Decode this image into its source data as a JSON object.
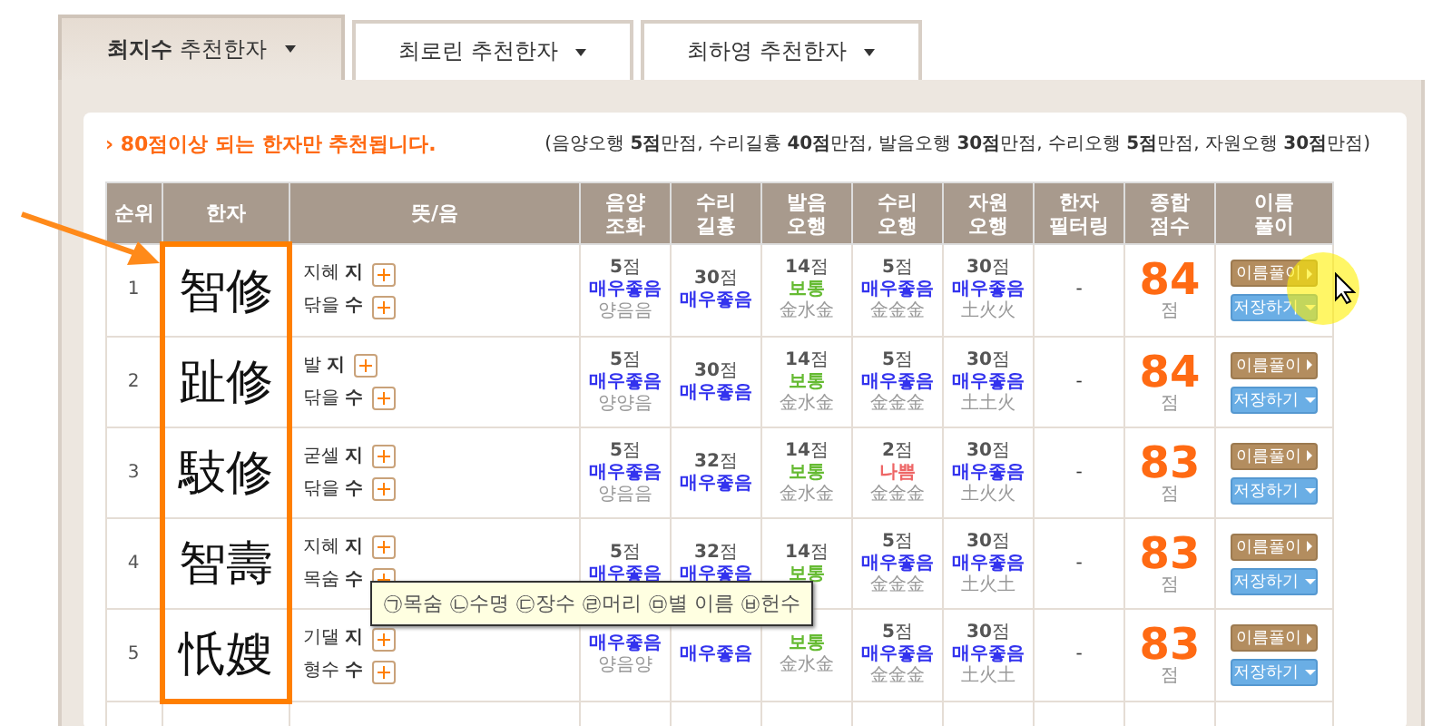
{
  "tabs": [
    {
      "label": "**최지수** 추천한자",
      "selected": true
    },
    {
      "label": "최로린 추천한자",
      "selected": false
    },
    {
      "label": "최하영 추천한자",
      "selected": false
    }
  ],
  "notice": "› 80점이상 되는 한자만 추천됩니다.",
  "legend": "(음양오행 **5점**만점, 수리길흉 **40점**만점, 발음오행 **30점**만점, 수리오행 **5점**만점, 자원오행 **30점**만점)",
  "columns": [
    [
      "순위"
    ],
    [
      "한자"
    ],
    [
      "뜻/음"
    ],
    [
      "음양",
      "조화"
    ],
    [
      "수리",
      "길흉"
    ],
    [
      "발음",
      "오행"
    ],
    [
      "수리",
      "오행"
    ],
    [
      "자원",
      "오행"
    ],
    [
      "한자",
      "필터링"
    ],
    [
      "종합",
      "점수"
    ],
    [
      "이름",
      "풀이"
    ]
  ],
  "rows": [
    {
      "rank": "1",
      "hanja": "智修",
      "readings": [
        {
          "meaning": "지혜",
          "sound": "지"
        },
        {
          "meaning": "닦을",
          "sound": "수"
        }
      ],
      "scores": [
        {
          "score": "**5**점",
          "verdict": "매우좋음",
          "kind": "great",
          "detail": "양음음"
        },
        {
          "score": "**30**점",
          "verdict": "매우좋음",
          "kind": "great"
        },
        {
          "score": "**14**점",
          "verdict": "보통",
          "kind": "normal",
          "detail": "金水金"
        },
        {
          "score": "**5**점",
          "verdict": "매우좋음",
          "kind": "great",
          "detail": "金金金"
        },
        {
          "score": "**30**점",
          "verdict": "매우좋음",
          "kind": "great",
          "detail": "土火火"
        }
      ],
      "filter": "-",
      "total": "84",
      "unit": "점",
      "buttons": [
        "이름풀이",
        "저장하기"
      ]
    },
    {
      "rank": "2",
      "hanja": "趾修",
      "readings": [
        {
          "meaning": "발",
          "sound": "지"
        },
        {
          "meaning": "닦을",
          "sound": "수"
        }
      ],
      "scores": [
        {
          "score": "**5**점",
          "verdict": "매우좋음",
          "kind": "great",
          "detail": "양양음"
        },
        {
          "score": "**30**점",
          "verdict": "매우좋음",
          "kind": "great"
        },
        {
          "score": "**14**점",
          "verdict": "보통",
          "kind": "normal",
          "detail": "金水金"
        },
        {
          "score": "**5**점",
          "verdict": "매우좋음",
          "kind": "great",
          "detail": "金金金"
        },
        {
          "score": "**30**점",
          "verdict": "매우좋음",
          "kind": "great",
          "detail": "土土火"
        }
      ],
      "filter": "-",
      "total": "84",
      "unit": "점",
      "buttons": [
        "이름풀이",
        "저장하기"
      ]
    },
    {
      "rank": "3",
      "hanja": "馶修",
      "readings": [
        {
          "meaning": "굳셀",
          "sound": "지"
        },
        {
          "meaning": "닦을",
          "sound": "수"
        }
      ],
      "scores": [
        {
          "score": "**5**점",
          "verdict": "매우좋음",
          "kind": "great",
          "detail": "양음음"
        },
        {
          "score": "**32**점",
          "verdict": "매우좋음",
          "kind": "great"
        },
        {
          "score": "**14**점",
          "verdict": "보통",
          "kind": "normal",
          "detail": "金水金"
        },
        {
          "score": "**2**점",
          "verdict": "나쁨",
          "kind": "bad",
          "detail": "金金金"
        },
        {
          "score": "**30**점",
          "verdict": "매우좋음",
          "kind": "great",
          "detail": "土火火"
        }
      ],
      "filter": "-",
      "total": "83",
      "unit": "점",
      "buttons": [
        "이름풀이",
        "저장하기"
      ]
    },
    {
      "rank": "4",
      "hanja": "智壽",
      "readings": [
        {
          "meaning": "지혜",
          "sound": "지"
        },
        {
          "meaning": "목숨",
          "sound": "수"
        }
      ],
      "scores": [
        {
          "score": "**5**점",
          "verdict": "매우좋음",
          "kind": "great"
        },
        {
          "score": "**32**점",
          "verdict": "매우좋음",
          "kind": "great"
        },
        {
          "score": "**14**점",
          "verdict": "보통",
          "kind": "normal"
        },
        {
          "score": "**5**점",
          "verdict": "매우좋음",
          "kind": "great",
          "detail": "金金金"
        },
        {
          "score": "**30**점",
          "verdict": "매우좋음",
          "kind": "great",
          "detail": "土火土"
        }
      ],
      "filter": "-",
      "total": "83",
      "unit": "점",
      "buttons": [
        "이름풀이",
        "저장하기"
      ]
    },
    {
      "rank": "5",
      "hanja": "忯嫂",
      "readings": [
        {
          "meaning": "기댈",
          "sound": "지"
        },
        {
          "meaning": "형수",
          "sound": "수"
        }
      ],
      "scores": [
        {
          "verdict": "매우좋음",
          "kind": "great",
          "detail": "양음양"
        },
        {
          "verdict": "매우좋음",
          "kind": "great"
        },
        {
          "verdict": "보통",
          "kind": "normal",
          "detail": "金水金"
        },
        {
          "score": "**5**점",
          "verdict": "매우좋음",
          "kind": "great",
          "detail": "金金金"
        },
        {
          "score": "**30**점",
          "verdict": "매우좋음",
          "kind": "great",
          "detail": "土火土"
        }
      ],
      "filter": "-",
      "total": "83",
      "unit": "점",
      "buttons": [
        "이름풀이",
        "저장하기"
      ]
    }
  ],
  "tooltip": "㉠목숨 ㉡수명 ㉢장수 ㉣머리 ㉤별 이름 ㉥헌수"
}
